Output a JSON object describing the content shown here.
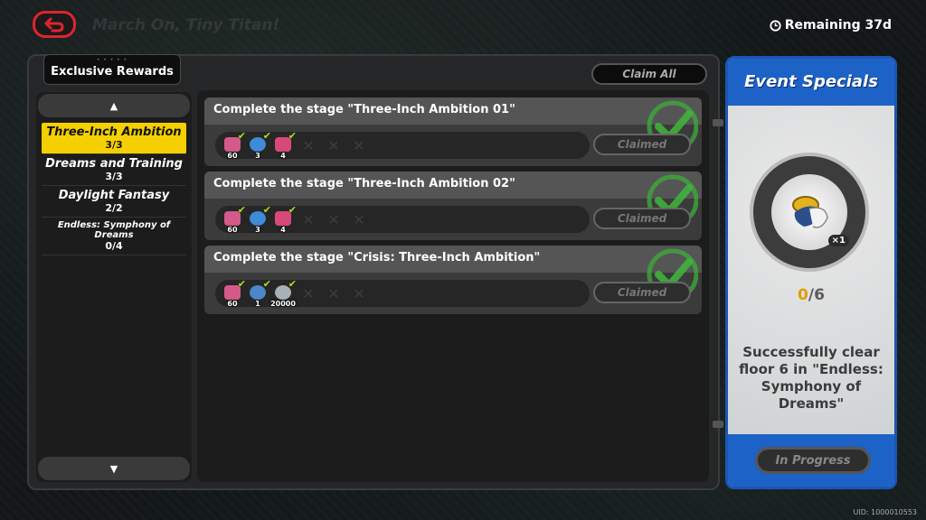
{
  "top": {
    "title": "March On, Tiny Titan!",
    "remaining": "Remaining 37d"
  },
  "left": {
    "tab_label": "Exclusive Rewards",
    "categories": [
      {
        "name": "Three-Inch Ambition",
        "count": "3/3",
        "active": true
      },
      {
        "name": "Dreams and Training",
        "count": "3/3"
      },
      {
        "name": "Daylight Fantasy",
        "count": "2/2"
      },
      {
        "name": "Endless: Symphony of Dreams",
        "count": "0/4"
      }
    ]
  },
  "claim_all": "Claim All",
  "tasks": [
    {
      "title": "Complete the stage \"Three-Inch Ambition 01\"",
      "rewards": [
        {
          "icon": "ticket-icon",
          "qty": "60",
          "color": "#d45a8a"
        },
        {
          "icon": "blue-gem-icon",
          "qty": "3",
          "color": "#3e8bd8"
        },
        {
          "icon": "pink-car-icon",
          "qty": "4",
          "color": "#d74a78"
        }
      ],
      "status": "Claimed"
    },
    {
      "title": "Complete the stage \"Three-Inch Ambition 02\"",
      "rewards": [
        {
          "icon": "ticket-icon",
          "qty": "60",
          "color": "#d45a8a"
        },
        {
          "icon": "blue-gem-icon",
          "qty": "3",
          "color": "#3e8bd8"
        },
        {
          "icon": "pink-shoe-icon",
          "qty": "4",
          "color": "#d74a78"
        }
      ],
      "status": "Claimed"
    },
    {
      "title": "Complete the stage \"Crisis: Three-Inch Ambition\"",
      "rewards": [
        {
          "icon": "ticket-icon",
          "qty": "60",
          "color": "#d45a8a"
        },
        {
          "icon": "gold-token-icon",
          "qty": "1",
          "color": "#4b88c9"
        },
        {
          "icon": "silver-coin-icon",
          "qty": "20000",
          "color": "#a8b0b8"
        }
      ],
      "status": "Claimed"
    }
  ],
  "side": {
    "title": "Event Specials",
    "medal_qty": "×1",
    "progress_current": "0",
    "progress_total": "/6",
    "description": "Successfully clear floor 6 in \"Endless: Symphony of Dreams\"",
    "button": "In Progress"
  },
  "uid": "UID: 1000010553",
  "colors": {
    "accent_yellow": "#f5d000",
    "panel_blue": "#1d62c7",
    "check_green": "#a8e01c",
    "back_red": "#e0242c"
  }
}
